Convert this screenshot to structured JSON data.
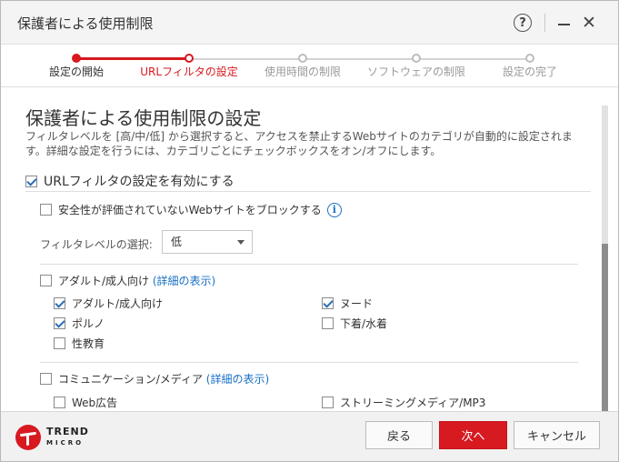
{
  "window": {
    "title": "保護者による使用制限"
  },
  "steps": [
    {
      "label": "設定の開始",
      "state": "done"
    },
    {
      "label": "URLフィルタの設定",
      "state": "current"
    },
    {
      "label": "使用時間の制限",
      "state": "future"
    },
    {
      "label": "ソフトウェアの制限",
      "state": "future"
    },
    {
      "label": "設定の完了",
      "state": "future"
    }
  ],
  "main": {
    "heading": "保護者による使用制限の設定",
    "description": "フィルタレベルを [高/中/低] から選択すると、アクセスを禁止するWebサイトのカテゴリが自動的に設定されます。詳細な設定を行うには、カテゴリごとにチェックボックスをオン/オフにします。",
    "enable_url_filter": {
      "label": "URLフィルタの設定を有効にする",
      "checked": true
    },
    "block_unrated": {
      "label": "安全性が評価されていないWebサイトをブロックする",
      "checked": false,
      "icon": "info-icon"
    },
    "filter_level": {
      "label": "フィルタレベルの選択:",
      "value": "低"
    },
    "categories": [
      {
        "label": "アダルト/成人向け",
        "detail_link": "(詳細の表示)",
        "checked": false,
        "items": [
          {
            "label": "アダルト/成人向け",
            "checked": true
          },
          {
            "label": "ヌード",
            "checked": true
          },
          {
            "label": "ポルノ",
            "checked": true
          },
          {
            "label": "下着/水着",
            "checked": false
          },
          {
            "label": "性教育",
            "checked": false
          }
        ]
      },
      {
        "label": "コミュニケーション/メディア",
        "detail_link": "(詳細の表示)",
        "checked": false,
        "items": [
          {
            "label": "Web広告",
            "checked": false
          },
          {
            "label": "ストリーミングメディア/MP3",
            "checked": false
          }
        ]
      }
    ]
  },
  "footer": {
    "logo_line1": "TREND",
    "logo_line2": "MICRO",
    "back_label": "戻る",
    "next_label": "次へ",
    "cancel_label": "キャンセル"
  },
  "colors": {
    "accent": "#d71920",
    "link": "#1a70c6",
    "check": "#2a6fb5"
  }
}
